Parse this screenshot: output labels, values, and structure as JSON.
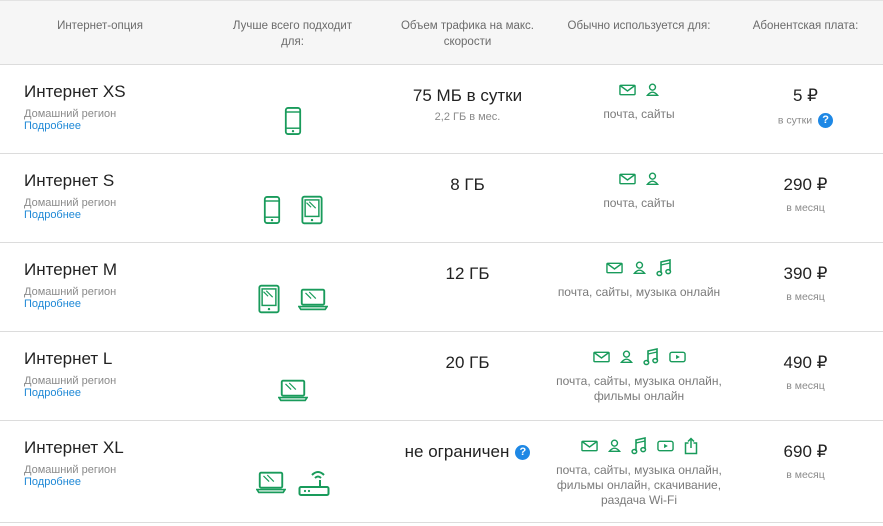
{
  "headers": {
    "option": "Интернет-опция",
    "best_for_1": "Лучше всего подходит",
    "best_for_2": "для:",
    "traffic_1": "Объем трафика на макс.",
    "traffic_2": "скорости",
    "usage": "Обычно используется для:",
    "fee": "Абонентская плата:"
  },
  "colors": {
    "accent": "#199b5b",
    "link": "#1e88d6",
    "help": "#1e88e5"
  },
  "rows": [
    {
      "name": "Интернет XS",
      "region": "Домашний регион",
      "more": "Подробнее",
      "devices": [
        "phone-icon"
      ],
      "traffic": "75 МБ в сутки",
      "traffic_sub": "2,2 ГБ в мес.",
      "usage_icons": [
        "mail-icon",
        "person-icon"
      ],
      "usage_text": "почта, сайты",
      "price": "5 ₽",
      "period": "в сутки"
    },
    {
      "name": "Интернет S",
      "region": "Домашний регион",
      "more": "Подробнее",
      "devices": [
        "phone-icon",
        "tablet-icon"
      ],
      "traffic": "8 ГБ",
      "traffic_sub": "",
      "usage_icons": [
        "mail-icon",
        "person-icon"
      ],
      "usage_text": "почта, сайты",
      "price": "290 ₽",
      "period": "в месяц"
    },
    {
      "name": "Интернет M",
      "region": "Домашний регион",
      "more": "Подробнее",
      "devices": [
        "tablet-icon",
        "laptop-icon"
      ],
      "traffic": "12 ГБ",
      "traffic_sub": "",
      "usage_icons": [
        "mail-icon",
        "person-icon",
        "music-icon"
      ],
      "usage_text": "почта, сайты, музыка онлайн",
      "price": "390 ₽",
      "period": "в месяц"
    },
    {
      "name": "Интернет L",
      "region": "Домашний регион",
      "more": "Подробнее",
      "devices": [
        "laptop-icon"
      ],
      "traffic": "20 ГБ",
      "traffic_sub": "",
      "usage_icons": [
        "mail-icon",
        "person-icon",
        "music-icon",
        "video-icon"
      ],
      "usage_text_1": "почта, сайты, музыка онлайн,",
      "usage_text_2": "фильмы онлайн",
      "price": "490 ₽",
      "period": "в месяц"
    },
    {
      "name": "Интернет XL",
      "region": "Домашний регион",
      "more": "Подробнее",
      "devices": [
        "laptop-icon",
        "router-icon"
      ],
      "traffic": "не ограничен",
      "traffic_sub": "",
      "usage_icons": [
        "mail-icon",
        "person-icon",
        "music-icon",
        "video-icon",
        "share-icon"
      ],
      "usage_text_1": "почта, сайты, музыка онлайн,",
      "usage_text_2": "фильмы онлайн, скачивание,",
      "usage_text_3": "раздача Wi-Fi",
      "price": "690 ₽",
      "period": "в месяц"
    }
  ]
}
